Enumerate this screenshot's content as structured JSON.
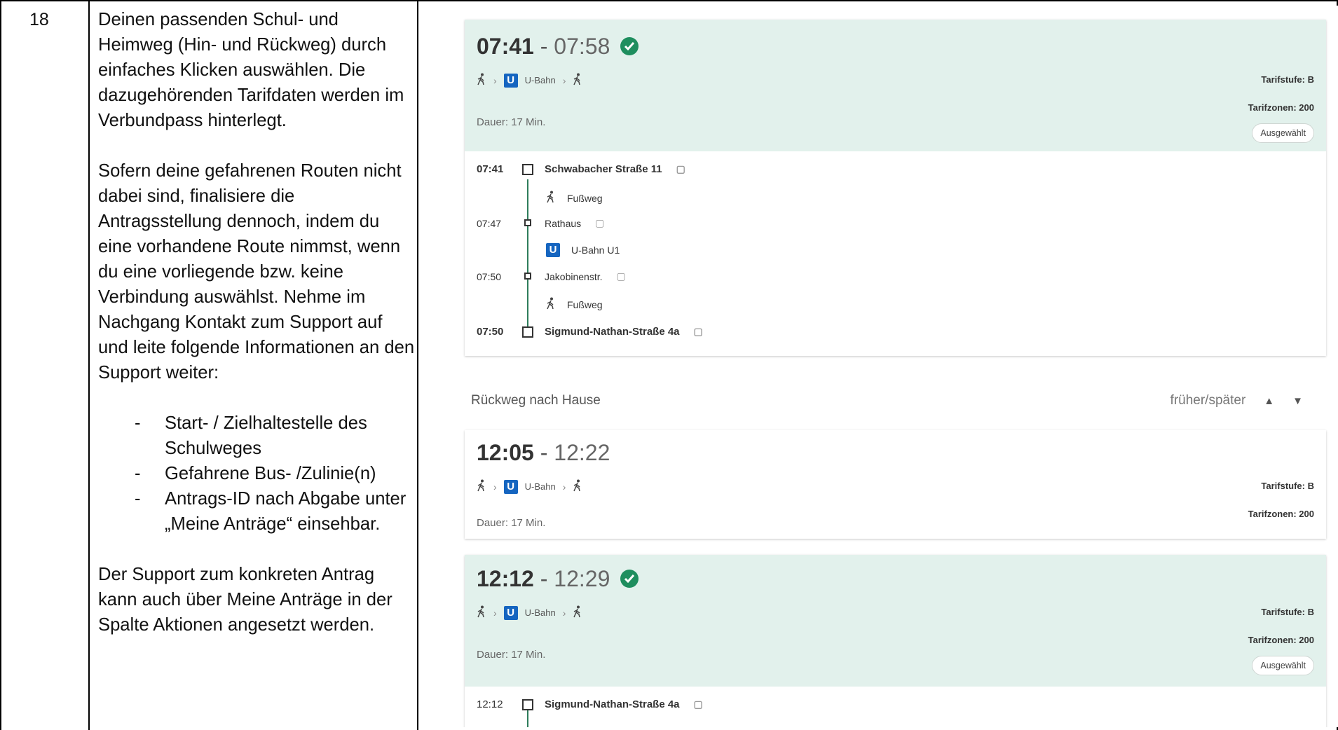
{
  "row": {
    "number": "18",
    "paragraph1": "Deinen passenden Schul- und Heimweg (Hin- und Rückweg) durch einfaches Klicken auswählen. Die dazugehörenden Tarifdaten werden im Verbundpass hinterlegt.",
    "paragraph2": "Sofern deine gefahrenen Routen nicht dabei sind, finalisiere die Antragsstellung dennoch, indem du eine vorhandene Route nimmst, wenn du eine vorliegende bzw. keine Verbindung auswählst. Nehme im Nachgang Kontakt zum Support auf und leite folgende Informationen an den Support weiter:",
    "bullets": [
      "Start- / Zielhaltestelle des Schulweges",
      "Gefahrene Bus- /Zulinie(n)",
      "Antrags-ID nach Abgabe unter „Meine Anträge“ einsehbar."
    ],
    "bullet_dash": "-",
    "paragraph3": "Der Support zum konkreten Antrag kann auch über Meine Anträge in der Spalte Aktionen angesetzt werden."
  },
  "app": {
    "colors": {
      "selected_bg": "#e2f1ec",
      "check": "#1e8e5e",
      "ubahn": "#1565c0",
      "route_line": "#2e7d5b"
    },
    "mode_icons": [
      "walk-icon",
      "ubahn-icon",
      "walk-icon"
    ],
    "separator": "-",
    "mode_chevron": "›",
    "trip1": {
      "dep": "07:41",
      "arr": "07:58",
      "mode": "U-Bahn",
      "u": "U",
      "tarifstufe": "Tarifstufe: B",
      "tarifzonen": "Tarifzonen: 200",
      "dauer": "Dauer: 17 Min.",
      "selected_label": "Ausgewählt",
      "stops": [
        {
          "time": "07:41",
          "name": "Schwabacher Straße 11"
        },
        {
          "time": "07:47",
          "name": "Rathaus"
        },
        {
          "time": "07:50",
          "name": "Jakobinenstr."
        },
        {
          "time": "07:50",
          "name": "Sigmund-Nathan-Straße 4a"
        }
      ],
      "legs": [
        "Fußweg",
        "U-Bahn U1",
        "Fußweg"
      ]
    },
    "return_section": {
      "title": "Rückweg nach Hause",
      "pager_label": "früher/später",
      "up": "▲",
      "down": "▼"
    },
    "trip2": {
      "dep": "12:05",
      "arr": "12:22",
      "mode": "U-Bahn",
      "u": "U",
      "tarifstufe": "Tarifstufe: B",
      "tarifzonen": "Tarifzonen: 200",
      "dauer": "Dauer: 17 Min."
    },
    "trip3": {
      "dep": "12:12",
      "arr": "12:29",
      "mode": "U-Bahn",
      "u": "U",
      "tarifstufe": "Tarifstufe: B",
      "tarifzonen": "Tarifzonen: 200",
      "dauer": "Dauer: 17 Min.",
      "selected_label": "Ausgewählt",
      "first_stop": {
        "time": "12:12",
        "name": "Sigmund-Nathan-Straße 4a"
      }
    }
  }
}
